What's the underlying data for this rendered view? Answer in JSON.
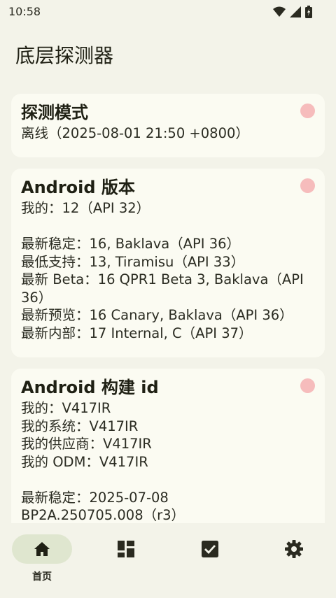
{
  "status_bar": {
    "time": "10:58",
    "icons": [
      "wifi-icon",
      "signal-icon",
      "battery-icon"
    ]
  },
  "app": {
    "title": "底层探测器"
  },
  "cards": {
    "mode": {
      "title": "探测模式",
      "lines": [
        "离线（2025-08-01 21:50 +0800）"
      ],
      "status_color": "#f6bcbc"
    },
    "android_version": {
      "title": "Android 版本",
      "mine": "我的：12（API 32）",
      "lines": [
        "最新稳定：16, Baklava（API 36）",
        "最低支持：13, Tiramisu（API 33）",
        "最新 Beta：16 QPR1 Beta 3, Baklava（API",
        "36）",
        "最新预览：16 Canary, Baklava（API 36）",
        "最新内部：17 Internal, C（API 37）"
      ],
      "status_color": "#f6bcbc"
    },
    "build_id": {
      "title": "Android 构建 id",
      "mine_lines": [
        "我的：V417IR",
        "我的系统：V417IR",
        "我的供应商：V417IR",
        "我的 ODM：V417IR"
      ],
      "lines": [
        "最新稳定：2025-07-08",
        "BP2A.250705.008（r3）"
      ],
      "status_color": "#f6bcbc"
    }
  },
  "bottom_nav": {
    "items": [
      {
        "label": "首页",
        "icon": "home-icon",
        "active": true
      },
      {
        "label": "",
        "icon": "dashboard-icon",
        "active": false
      },
      {
        "label": "",
        "icon": "checkbox-icon",
        "active": false
      },
      {
        "label": "",
        "icon": "gear-icon",
        "active": false
      }
    ]
  },
  "colors": {
    "background": "#f3f3e9",
    "card": "#fbfbf2",
    "active_nav": "#dfe6cf",
    "status_dot": "#f6bcbc"
  }
}
